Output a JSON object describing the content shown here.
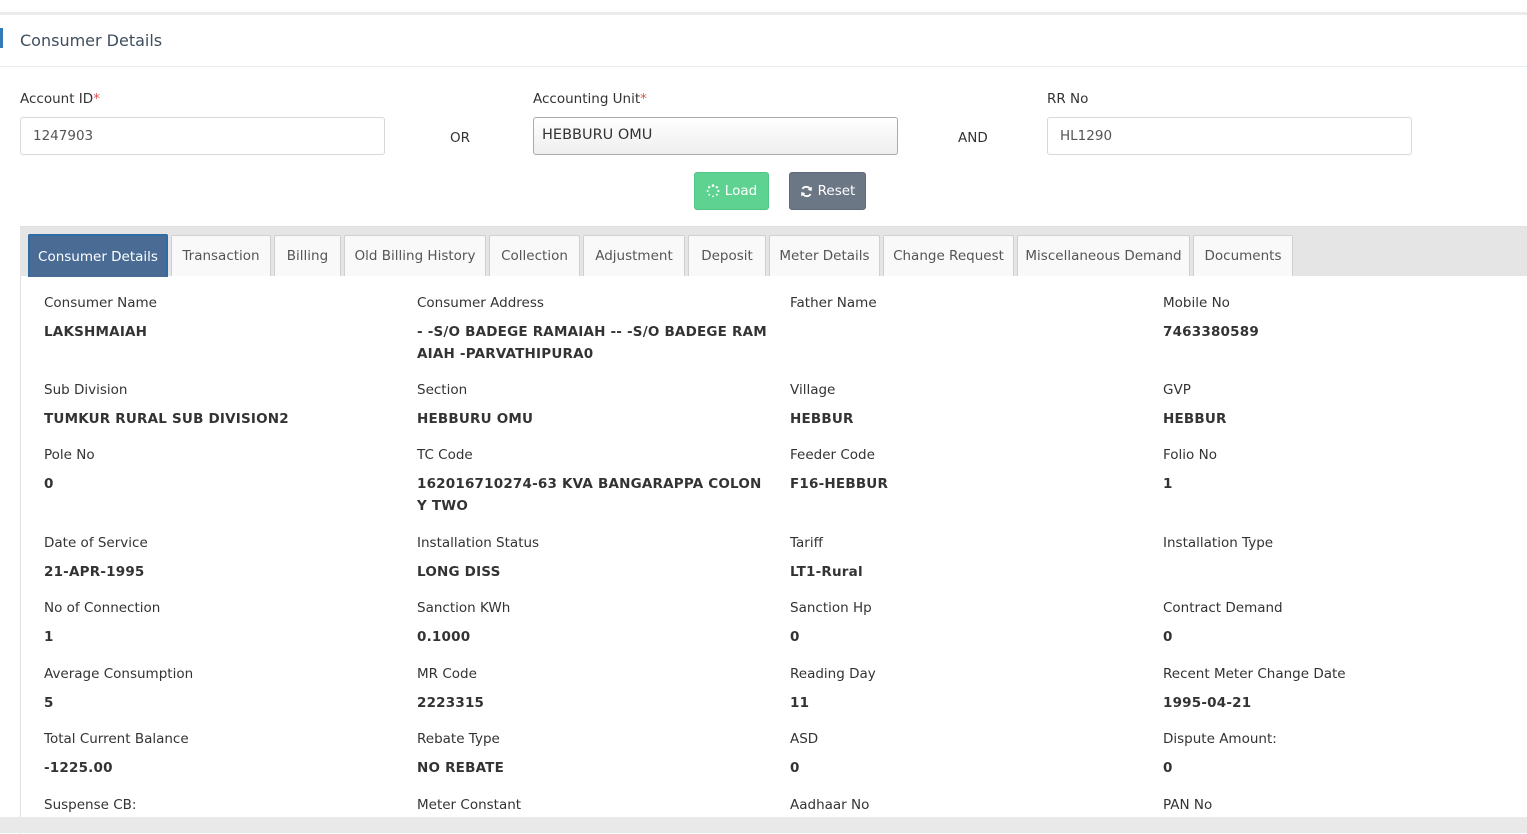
{
  "header": {
    "title": "Consumer Details"
  },
  "search": {
    "account_id_label": "Account ID",
    "account_id_value": "1247903",
    "or_label": "OR",
    "accounting_unit_label": "Accounting Unit",
    "accounting_unit_value": "HEBBURU OMU",
    "and_label": "AND",
    "rr_no_label": "RR No",
    "rr_no_value": "HL1290",
    "required_mark": "*",
    "load_label": "Load",
    "reset_label": "Reset",
    "load_color": "#5ed391",
    "reset_color": "#6c7786"
  },
  "tabs": [
    {
      "label": "Consumer Details",
      "active": true
    },
    {
      "label": "Transaction"
    },
    {
      "label": "Billing"
    },
    {
      "label": "Old Billing History"
    },
    {
      "label": "Collection"
    },
    {
      "label": "Adjustment"
    },
    {
      "label": "Deposit"
    },
    {
      "label": "Meter Details"
    },
    {
      "label": "Change Request"
    },
    {
      "label": "Miscellaneous Demand"
    },
    {
      "label": "Documents"
    }
  ],
  "details": {
    "consumer_name": {
      "label": "Consumer Name",
      "value": "LAKSHMAIAH"
    },
    "consumer_address": {
      "label": "Consumer Address",
      "value": "- -S/O BADEGE RAMAIAH -- -S/O BADEGE RAMAIAH -PARVATHIPURA0"
    },
    "father_name": {
      "label": "Father Name",
      "value": ""
    },
    "mobile_no": {
      "label": "Mobile No",
      "value": "7463380589"
    },
    "sub_division": {
      "label": "Sub Division",
      "value": "TUMKUR RURAL SUB DIVISION2"
    },
    "section": {
      "label": "Section",
      "value": "HEBBURU OMU"
    },
    "village": {
      "label": "Village",
      "value": "HEBBUR"
    },
    "gvp": {
      "label": "GVP",
      "value": "HEBBUR"
    },
    "pole_no": {
      "label": "Pole No",
      "value": "0"
    },
    "tc_code": {
      "label": "TC Code",
      "value": "162016710274-63 KVA BANGARAPPA COLONY TWO"
    },
    "feeder_code": {
      "label": "Feeder Code",
      "value": "F16-HEBBUR"
    },
    "folio_no": {
      "label": "Folio No",
      "value": "1"
    },
    "date_of_service": {
      "label": "Date of Service",
      "value": "21-APR-1995"
    },
    "installation_status": {
      "label": "Installation Status",
      "value": "LONG DISS"
    },
    "tariff": {
      "label": "Tariff",
      "value": "LT1-Rural"
    },
    "installation_type": {
      "label": "Installation Type",
      "value": ""
    },
    "no_of_connection": {
      "label": "No of Connection",
      "value": "1"
    },
    "sanction_kwh": {
      "label": "Sanction KWh",
      "value": "0.1000"
    },
    "sanction_hp": {
      "label": "Sanction Hp",
      "value": "0"
    },
    "contract_demand": {
      "label": "Contract Demand",
      "value": "0"
    },
    "average_consumption": {
      "label": "Average Consumption",
      "value": "5"
    },
    "mr_code": {
      "label": "MR Code",
      "value": "2223315"
    },
    "reading_day": {
      "label": "Reading Day",
      "value": "11"
    },
    "recent_meter_change_date": {
      "label": "Recent Meter Change Date",
      "value": "1995-04-21"
    },
    "total_current_balance": {
      "label": "Total Current Balance",
      "value": "-1225.00"
    },
    "rebate_type": {
      "label": "Rebate Type",
      "value": "NO REBATE"
    },
    "asd": {
      "label": "ASD",
      "value": "0"
    },
    "dispute_amount": {
      "label": "Dispute Amount:",
      "value": "0"
    },
    "suspense_cb": {
      "label": "Suspense CB:"
    },
    "meter_constant": {
      "label": "Meter Constant"
    },
    "aadhaar_no": {
      "label": "Aadhaar No"
    },
    "pan_no": {
      "label": "PAN No"
    }
  },
  "icons": {
    "load": "spinner-icon",
    "reset": "refresh-icon"
  },
  "colors": {
    "accent": "#337ab7",
    "active_tab": "#4a6c94",
    "required": "#d9534f"
  }
}
